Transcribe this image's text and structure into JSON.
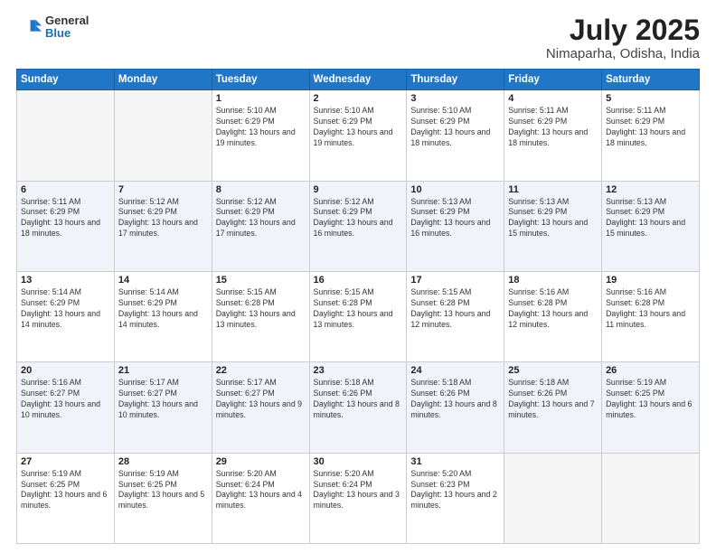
{
  "header": {
    "logo_general": "General",
    "logo_blue": "Blue",
    "title": "July 2025",
    "subtitle": "Nimaparha, Odisha, India"
  },
  "days_of_week": [
    "Sunday",
    "Monday",
    "Tuesday",
    "Wednesday",
    "Thursday",
    "Friday",
    "Saturday"
  ],
  "weeks": [
    [
      {
        "day": "",
        "empty": true
      },
      {
        "day": "",
        "empty": true
      },
      {
        "day": "1",
        "sunrise": "5:10 AM",
        "sunset": "6:29 PM",
        "daylight": "13 hours and 19 minutes."
      },
      {
        "day": "2",
        "sunrise": "5:10 AM",
        "sunset": "6:29 PM",
        "daylight": "13 hours and 19 minutes."
      },
      {
        "day": "3",
        "sunrise": "5:10 AM",
        "sunset": "6:29 PM",
        "daylight": "13 hours and 18 minutes."
      },
      {
        "day": "4",
        "sunrise": "5:11 AM",
        "sunset": "6:29 PM",
        "daylight": "13 hours and 18 minutes."
      },
      {
        "day": "5",
        "sunrise": "5:11 AM",
        "sunset": "6:29 PM",
        "daylight": "13 hours and 18 minutes."
      }
    ],
    [
      {
        "day": "6",
        "sunrise": "5:11 AM",
        "sunset": "6:29 PM",
        "daylight": "13 hours and 18 minutes."
      },
      {
        "day": "7",
        "sunrise": "5:12 AM",
        "sunset": "6:29 PM",
        "daylight": "13 hours and 17 minutes."
      },
      {
        "day": "8",
        "sunrise": "5:12 AM",
        "sunset": "6:29 PM",
        "daylight": "13 hours and 17 minutes."
      },
      {
        "day": "9",
        "sunrise": "5:12 AM",
        "sunset": "6:29 PM",
        "daylight": "13 hours and 16 minutes."
      },
      {
        "day": "10",
        "sunrise": "5:13 AM",
        "sunset": "6:29 PM",
        "daylight": "13 hours and 16 minutes."
      },
      {
        "day": "11",
        "sunrise": "5:13 AM",
        "sunset": "6:29 PM",
        "daylight": "13 hours and 15 minutes."
      },
      {
        "day": "12",
        "sunrise": "5:13 AM",
        "sunset": "6:29 PM",
        "daylight": "13 hours and 15 minutes."
      }
    ],
    [
      {
        "day": "13",
        "sunrise": "5:14 AM",
        "sunset": "6:29 PM",
        "daylight": "13 hours and 14 minutes."
      },
      {
        "day": "14",
        "sunrise": "5:14 AM",
        "sunset": "6:29 PM",
        "daylight": "13 hours and 14 minutes."
      },
      {
        "day": "15",
        "sunrise": "5:15 AM",
        "sunset": "6:28 PM",
        "daylight": "13 hours and 13 minutes."
      },
      {
        "day": "16",
        "sunrise": "5:15 AM",
        "sunset": "6:28 PM",
        "daylight": "13 hours and 13 minutes."
      },
      {
        "day": "17",
        "sunrise": "5:15 AM",
        "sunset": "6:28 PM",
        "daylight": "13 hours and 12 minutes."
      },
      {
        "day": "18",
        "sunrise": "5:16 AM",
        "sunset": "6:28 PM",
        "daylight": "13 hours and 12 minutes."
      },
      {
        "day": "19",
        "sunrise": "5:16 AM",
        "sunset": "6:28 PM",
        "daylight": "13 hours and 11 minutes."
      }
    ],
    [
      {
        "day": "20",
        "sunrise": "5:16 AM",
        "sunset": "6:27 PM",
        "daylight": "13 hours and 10 minutes."
      },
      {
        "day": "21",
        "sunrise": "5:17 AM",
        "sunset": "6:27 PM",
        "daylight": "13 hours and 10 minutes."
      },
      {
        "day": "22",
        "sunrise": "5:17 AM",
        "sunset": "6:27 PM",
        "daylight": "13 hours and 9 minutes."
      },
      {
        "day": "23",
        "sunrise": "5:18 AM",
        "sunset": "6:26 PM",
        "daylight": "13 hours and 8 minutes."
      },
      {
        "day": "24",
        "sunrise": "5:18 AM",
        "sunset": "6:26 PM",
        "daylight": "13 hours and 8 minutes."
      },
      {
        "day": "25",
        "sunrise": "5:18 AM",
        "sunset": "6:26 PM",
        "daylight": "13 hours and 7 minutes."
      },
      {
        "day": "26",
        "sunrise": "5:19 AM",
        "sunset": "6:25 PM",
        "daylight": "13 hours and 6 minutes."
      }
    ],
    [
      {
        "day": "27",
        "sunrise": "5:19 AM",
        "sunset": "6:25 PM",
        "daylight": "13 hours and 6 minutes."
      },
      {
        "day": "28",
        "sunrise": "5:19 AM",
        "sunset": "6:25 PM",
        "daylight": "13 hours and 5 minutes."
      },
      {
        "day": "29",
        "sunrise": "5:20 AM",
        "sunset": "6:24 PM",
        "daylight": "13 hours and 4 minutes."
      },
      {
        "day": "30",
        "sunrise": "5:20 AM",
        "sunset": "6:24 PM",
        "daylight": "13 hours and 3 minutes."
      },
      {
        "day": "31",
        "sunrise": "5:20 AM",
        "sunset": "6:23 PM",
        "daylight": "13 hours and 2 minutes."
      },
      {
        "day": "",
        "empty": true
      },
      {
        "day": "",
        "empty": true
      }
    ]
  ]
}
